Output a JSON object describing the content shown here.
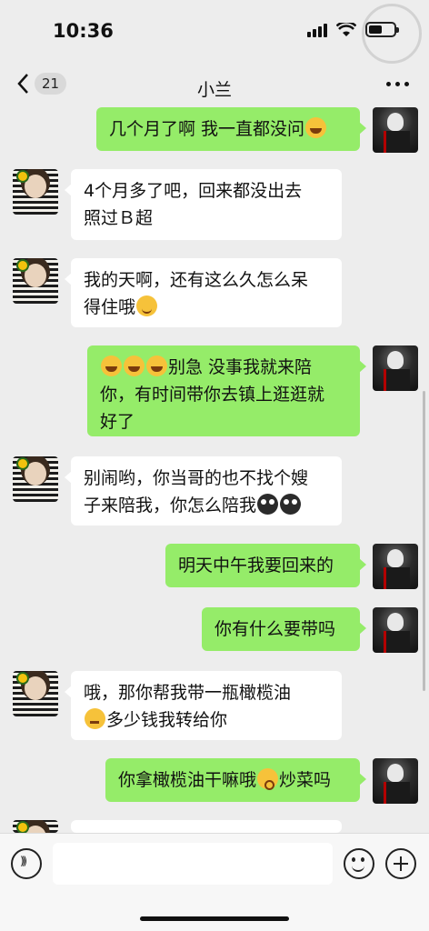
{
  "status": {
    "time": "10:36"
  },
  "watermark": {
    "text": ""
  },
  "nav": {
    "unread": "21",
    "title": "小兰"
  },
  "messages": [
    {
      "from": "me",
      "text": "几个月了啊 我一直都没问",
      "emoji_after": "laugh-cry-emoji"
    },
    {
      "from": "her",
      "lines": [
        "4个月多了吧，回来都没出去",
        "照过Ｂ超"
      ]
    },
    {
      "from": "her",
      "lines": [
        "我的天啊，还有这么久怎么呆",
        "得住哦"
      ],
      "emoji_after": "smile-emoji"
    },
    {
      "from": "me",
      "emoji_before": [
        "laugh-cry-emoji",
        "laugh-cry-emoji",
        "laugh-cry-emoji"
      ],
      "lines": [
        "别急 没事我就来陪",
        "你，有时间带你去镇上逛逛就",
        "好了"
      ]
    },
    {
      "from": "her",
      "lines": [
        "别闹哟，你当哥的也不找个嫂",
        "子来陪我，你怎么陪我"
      ],
      "emoji_after": [
        "shocked-emoji",
        "shocked-emoji"
      ]
    },
    {
      "from": "me",
      "text": "明天中午我要回来的"
    },
    {
      "from": "me",
      "text": "你有什么要带吗"
    },
    {
      "from": "her",
      "lines": [
        "哦，那你帮我带一瓶橄榄油",
        "多少钱我转给你"
      ],
      "emoji_before_line2": "thinking-emoji"
    },
    {
      "from": "me",
      "text_a": "你拿橄榄油干嘛哦",
      "text_b": "炒菜吗",
      "emoji_mid": "flushed-emoji"
    }
  ],
  "input": {
    "placeholder": ""
  }
}
